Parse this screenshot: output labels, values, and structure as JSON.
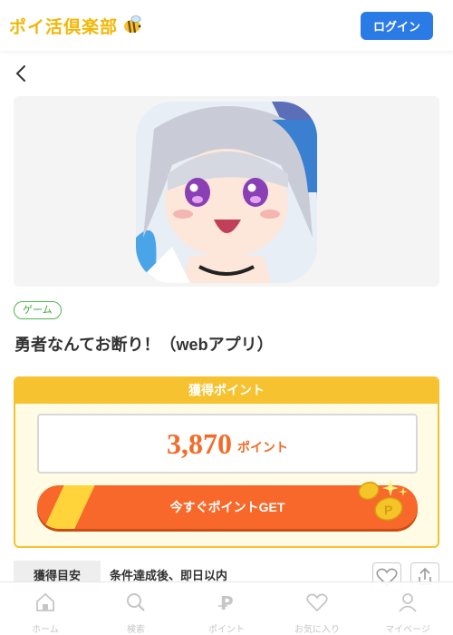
{
  "header": {
    "logo_text": "ポイ活倶楽部",
    "logo_icon": "bee-icon",
    "login_label": "ログイン"
  },
  "nav": {
    "back_icon": "chevron-left-icon"
  },
  "app": {
    "category_tag": "ゲーム",
    "title": "勇者なんてお断り！（webアプリ）"
  },
  "points": {
    "heading": "獲得ポイント",
    "value": "3,870",
    "unit": "ポイント",
    "cta_label": "今すぐポイントGET"
  },
  "meta": {
    "key": "獲得目安",
    "value": "条件達成後、即日以内"
  },
  "bottom_nav": {
    "items": [
      {
        "label": "ホーム",
        "icon": "home-icon"
      },
      {
        "label": "検索",
        "icon": "search-icon"
      },
      {
        "label": "ポイント",
        "icon": "point-icon"
      },
      {
        "label": "お気に入り",
        "icon": "heart-icon"
      },
      {
        "label": "マイページ",
        "icon": "user-icon"
      }
    ]
  },
  "colors": {
    "brand_yellow": "#f6c230",
    "accent_orange": "#f7682a",
    "login_blue": "#2b7be6",
    "tag_green": "#4cb84c"
  }
}
